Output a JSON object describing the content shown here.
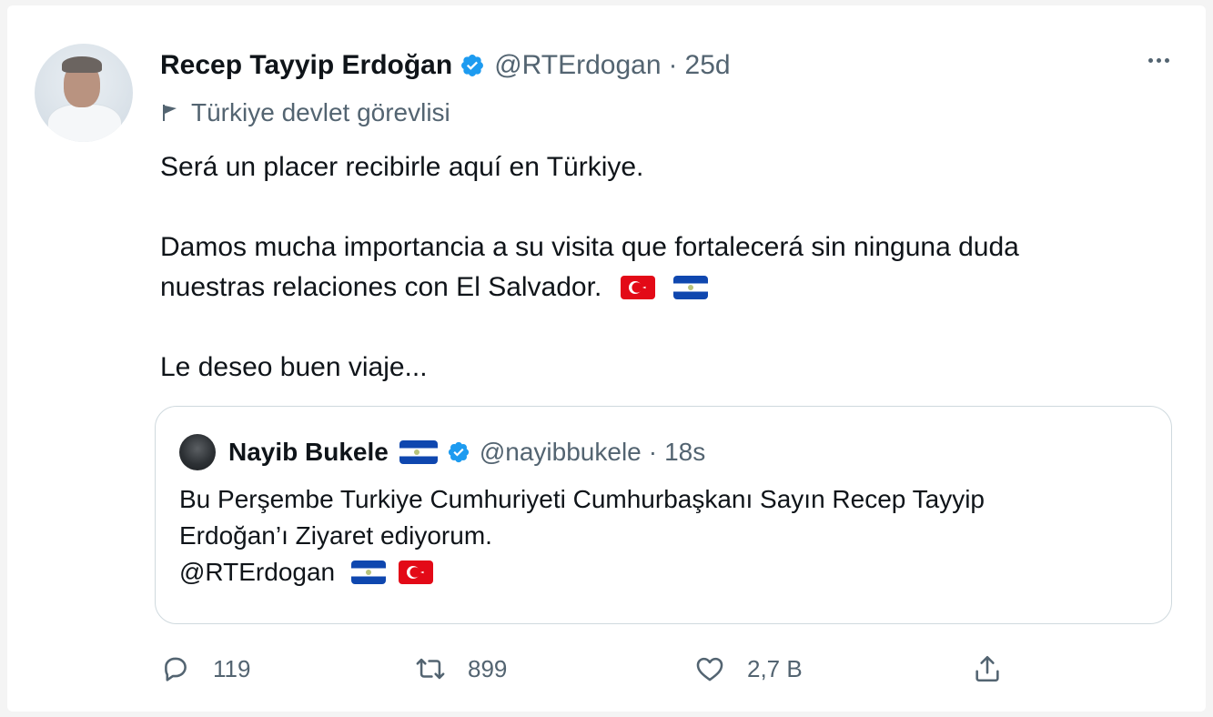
{
  "tweet": {
    "author_name": "Recep Tayyip Erdoğan",
    "author_handle": "@RTErdogan",
    "separator": "·",
    "time": "25d",
    "label": "Türkiye devlet görevlisi",
    "lines": [
      "Será un placer recibirle aquí en Türkiye.",
      "Damos mucha importancia a su visita que fortalecerá sin ninguna duda",
      "nuestras relaciones con El Salvador.",
      "Le deseo buen viaje..."
    ]
  },
  "quote": {
    "author_name": "Nayib Bukele",
    "author_handle": "@nayibbukele",
    "separator": "·",
    "time": "18s",
    "lines": [
      "Bu Perşembe Turkiye Cumhuriyeti Cumhurbaşkanı Sayın Recep Tayyip",
      "Erdoğan’ı Ziyaret ediyorum.",
      "@RTErdogan"
    ]
  },
  "actions": {
    "reply_count": "119",
    "retweet_count": "899",
    "like_count": "2,7 B"
  },
  "icons": {
    "verified": "verified-badge-icon",
    "label": "flag-icon",
    "more": "more-icon",
    "reply": "reply-icon",
    "retweet": "retweet-icon",
    "like": "heart-icon",
    "share": "share-icon"
  },
  "colors": {
    "verified_blue": "#1d9bf0",
    "secondary_text": "#536471",
    "primary_text": "#0f1419",
    "border": "#cfd9de"
  }
}
